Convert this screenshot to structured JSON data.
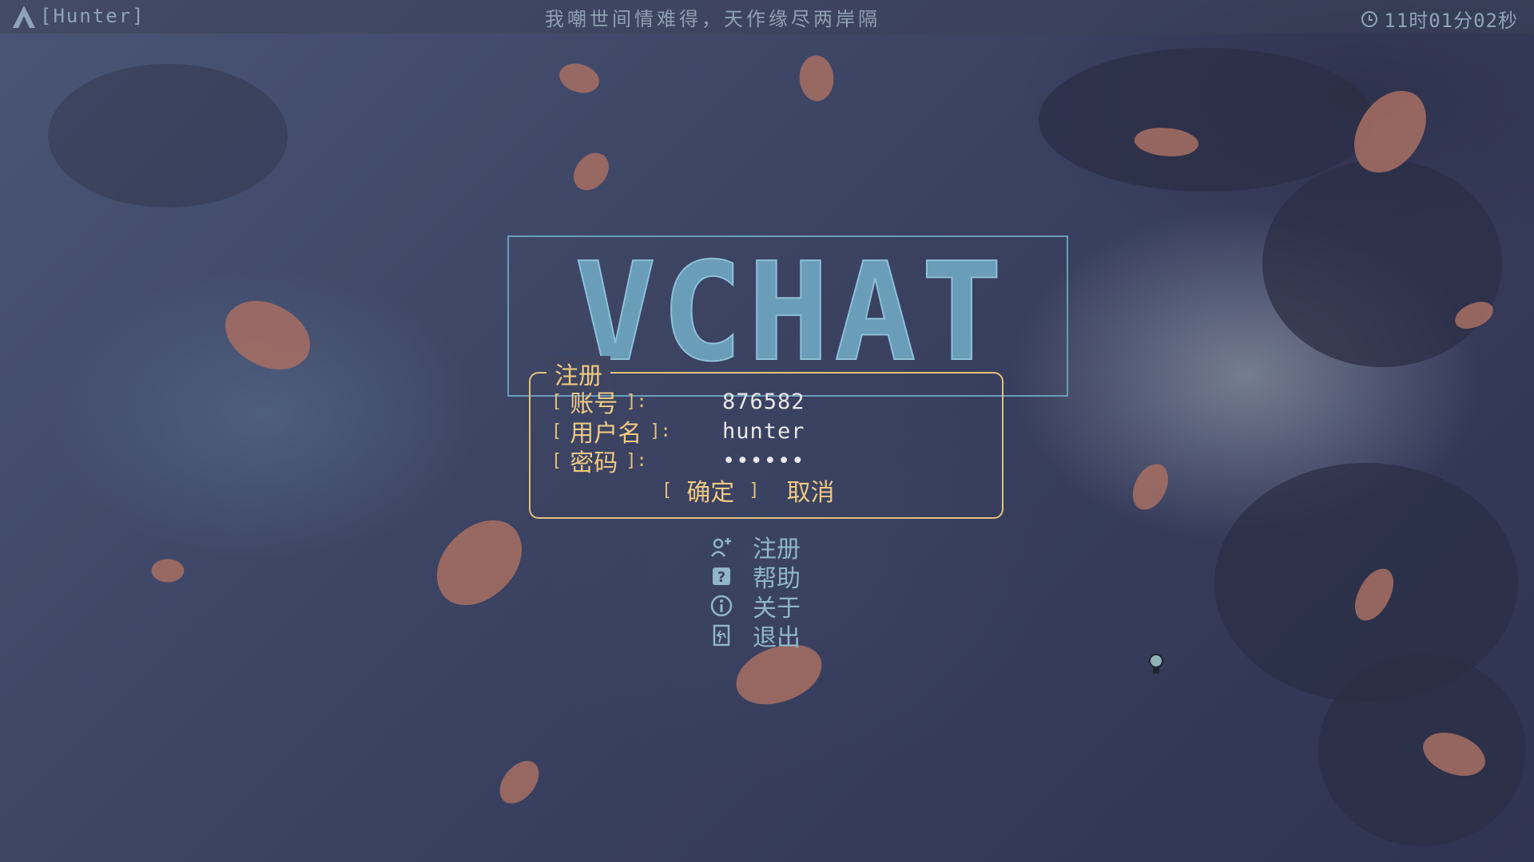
{
  "topbar": {
    "user_label": "[Hunter]",
    "poem": "我嘲世间情难得，天作缘尽两岸隔",
    "clock": "11时01分02秒"
  },
  "app": {
    "logo_text": "VCHAT"
  },
  "dialog": {
    "title": "注册",
    "fields": [
      {
        "open": "[",
        "label": "账号",
        "close": "]:",
        "value": "876582"
      },
      {
        "open": "[",
        "label": "用户名",
        "close": "]:",
        "value": "hunter"
      },
      {
        "open": "[",
        "label": "密码",
        "close": "]:",
        "value": "••••••"
      }
    ],
    "confirm_open": "[",
    "confirm_label": "确定",
    "confirm_close": "]",
    "cancel_label": "取消"
  },
  "menu": {
    "items": [
      {
        "icon": "add-user-icon",
        "label": "注册"
      },
      {
        "icon": "help-icon",
        "label": "帮助"
      },
      {
        "icon": "info-icon",
        "label": "关于"
      },
      {
        "icon": "exit-icon",
        "label": "退出"
      }
    ]
  },
  "colors": {
    "accent": "#e3c27a",
    "logo": "#6a9db8",
    "menu": "#8fb6c8",
    "topbar_text": "#8fa3b8"
  }
}
